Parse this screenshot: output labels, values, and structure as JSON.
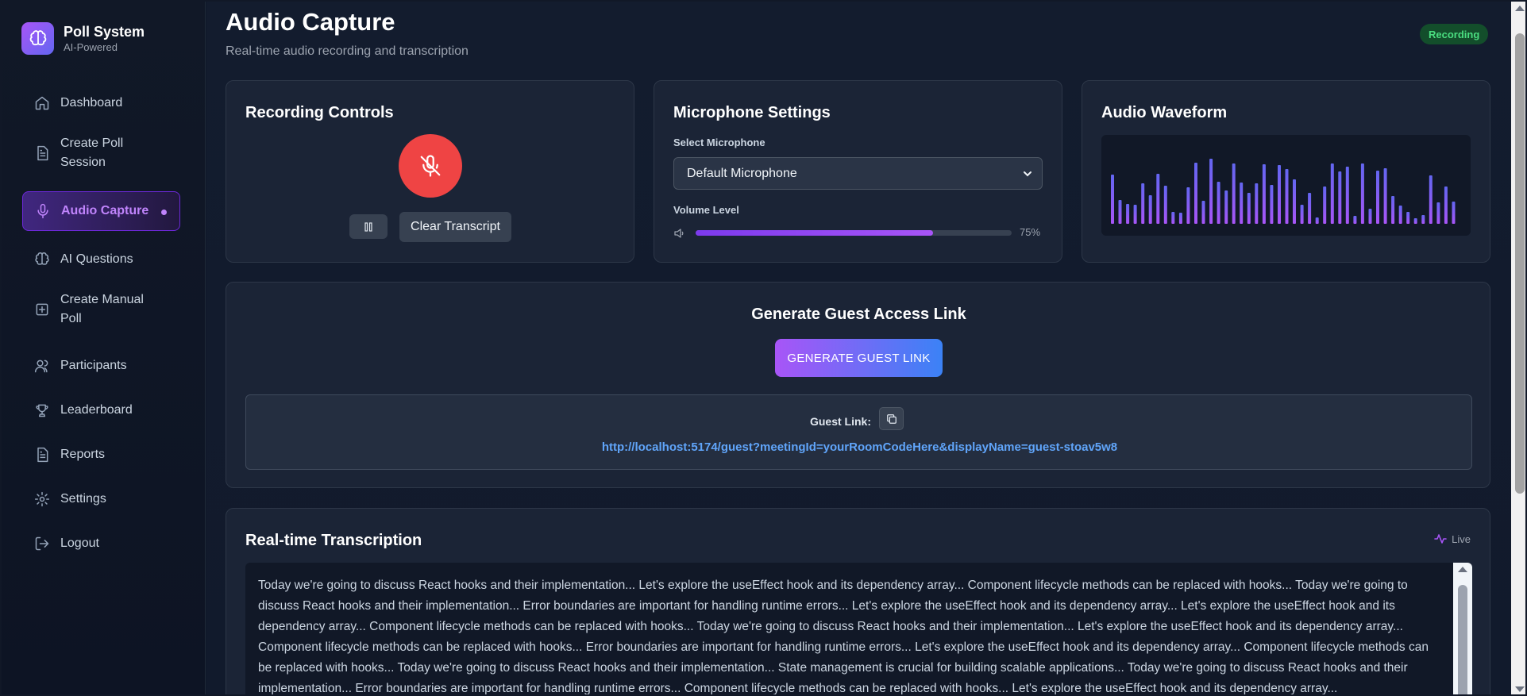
{
  "brand": {
    "title": "Poll System",
    "subtitle": "AI-Powered"
  },
  "sidebar": {
    "items": [
      {
        "label": "Dashboard",
        "icon": "home-icon"
      },
      {
        "label": "Create Poll Session",
        "icon": "document-icon"
      },
      {
        "label": "Audio Capture",
        "icon": "microphone-icon",
        "active": true
      },
      {
        "label": "AI Questions",
        "icon": "brain-icon"
      },
      {
        "label": "Create Manual Poll",
        "icon": "plus-square-icon"
      },
      {
        "label": "Participants",
        "icon": "users-icon"
      },
      {
        "label": "Leaderboard",
        "icon": "trophy-icon"
      },
      {
        "label": "Reports",
        "icon": "document-icon"
      },
      {
        "label": "Settings",
        "icon": "gear-icon"
      },
      {
        "label": "Logout",
        "icon": "logout-icon"
      }
    ]
  },
  "header": {
    "title": "Audio Capture",
    "subtitle": "Real-time audio recording and transcription",
    "status": "Recording"
  },
  "recording": {
    "title": "Recording Controls",
    "clear_label": "Clear Transcript",
    "mic_state": "muted"
  },
  "microphone": {
    "title": "Microphone Settings",
    "select_label": "Select Microphone",
    "selected": "Default Microphone",
    "volume_label": "Volume Level",
    "volume": 0.75,
    "volume_text": "75%"
  },
  "waveform": {
    "title": "Audio Waveform",
    "levels": [
      0.62,
      0.3,
      0.25,
      0.24,
      0.51,
      0.36,
      0.63,
      0.48,
      0.15,
      0.14,
      0.46,
      0.77,
      0.29,
      0.82,
      0.53,
      0.42,
      0.76,
      0.52,
      0.39,
      0.51,
      0.75,
      0.49,
      0.74,
      0.69,
      0.56,
      0.24,
      0.39,
      0.08,
      0.47,
      0.76,
      0.66,
      0.72,
      0.1,
      0.76,
      0.19,
      0.67,
      0.7,
      0.35,
      0.23,
      0.15,
      0.07,
      0.11,
      0.61,
      0.27,
      0.47,
      0.28
    ],
    "color_top": "#6366f1",
    "color_bottom": "#a855f7"
  },
  "guest": {
    "title": "Generate Guest Access Link",
    "button_label": "GENERATE GUEST LINK",
    "link_label": "Guest Link:",
    "url": "http://localhost:5174/guest?meetingId=yourRoomCodeHere&displayName=guest-stoav5w8"
  },
  "transcription": {
    "title": "Real-time Transcription",
    "live_label": "Live",
    "text": "Today we're going to discuss React hooks and their implementation... Let's explore the useEffect hook and its dependency array... Component lifecycle methods can be replaced with hooks... Today we're going to discuss React hooks and their implementation... Error boundaries are important for handling runtime errors... Let's explore the useEffect hook and its dependency array... Let's explore the useEffect hook and its dependency array... Component lifecycle methods can be replaced with hooks... Today we're going to discuss React hooks and their implementation... Let's explore the useEffect hook and its dependency array... Component lifecycle methods can be replaced with hooks... Error boundaries are important for handling runtime errors... Let's explore the useEffect hook and its dependency array... Component lifecycle methods can be replaced with hooks... Today we're going to discuss React hooks and their implementation... State management is crucial for building scalable applications... Today we're going to discuss React hooks and their implementation... Error boundaries are important for handling runtime errors... Component lifecycle methods can be replaced with hooks... Let's explore the useEffect hook and its dependency array..."
  }
}
